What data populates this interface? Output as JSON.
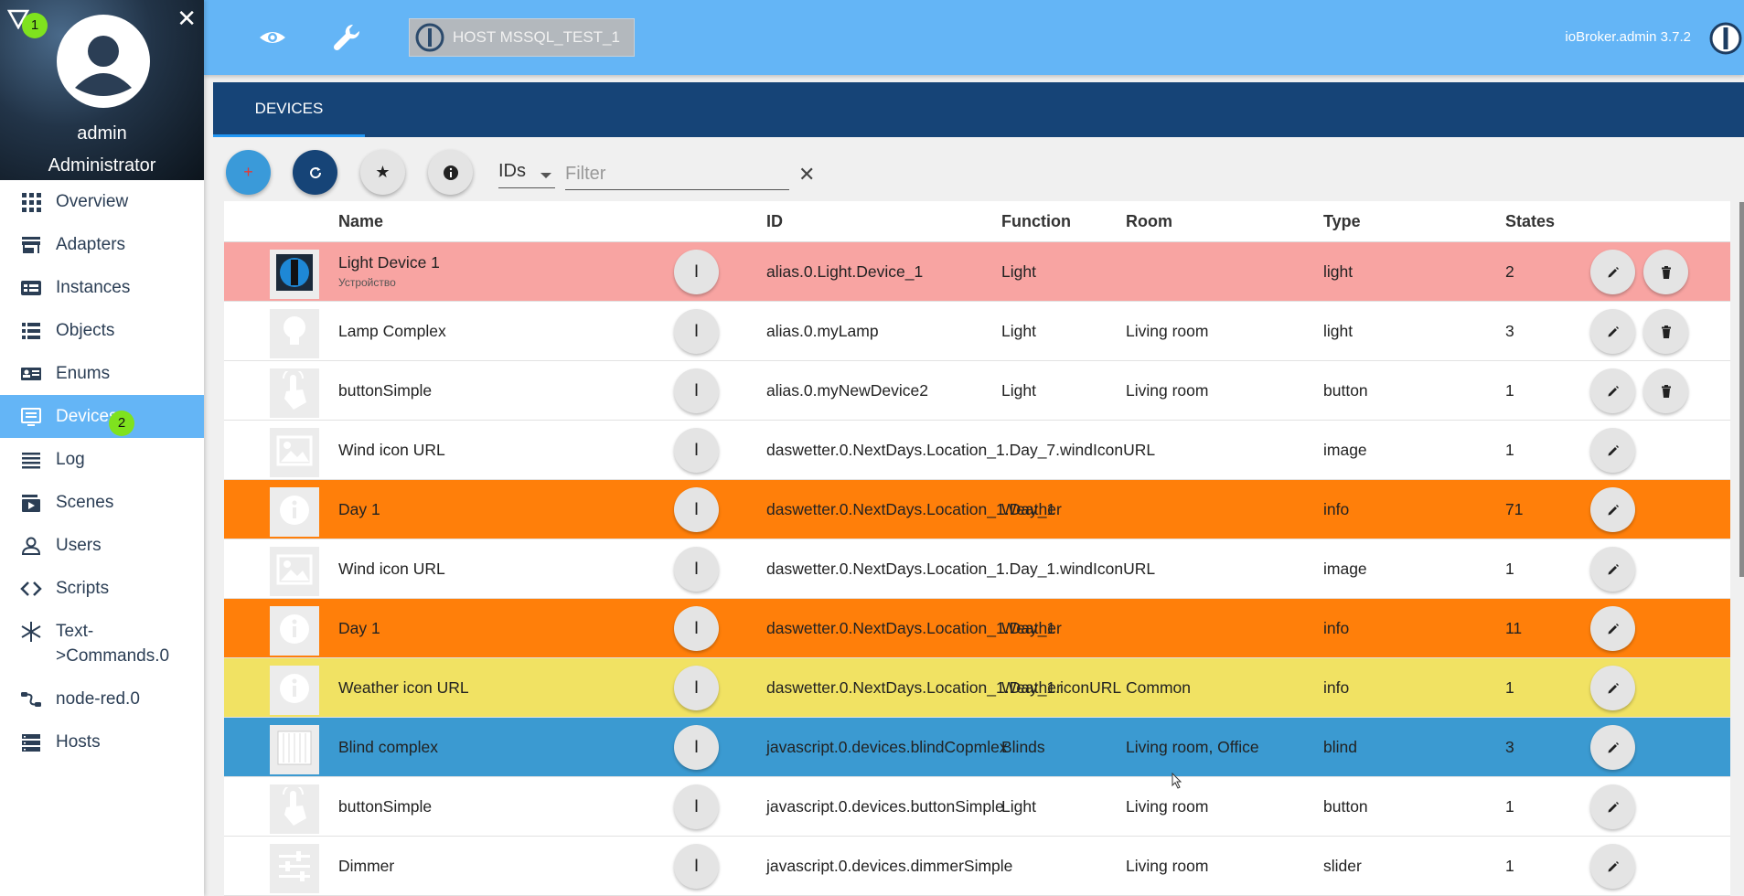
{
  "sidebar": {
    "profile": {
      "name": "admin",
      "role": "Administrator",
      "badge": "1"
    },
    "items": [
      {
        "label": "Overview",
        "icon": "grid-icon"
      },
      {
        "label": "Adapters",
        "icon": "store-icon"
      },
      {
        "label": "Instances",
        "icon": "instances-icon"
      },
      {
        "label": "Objects",
        "icon": "list-icon"
      },
      {
        "label": "Enums",
        "icon": "enum-icon"
      },
      {
        "label": "Devices",
        "icon": "devices-icon",
        "badge": "2"
      },
      {
        "label": "Log",
        "icon": "log-icon"
      },
      {
        "label": "Scenes",
        "icon": "scenes-icon"
      },
      {
        "label": "Users",
        "icon": "user-icon"
      },
      {
        "label": "Scripts",
        "icon": "code-icon"
      },
      {
        "label": "Text-\n>Commands.0",
        "icon": "snowflake-icon"
      },
      {
        "label": "node-red.0",
        "icon": "node-red-icon"
      },
      {
        "label": "Hosts",
        "icon": "hosts-icon"
      }
    ]
  },
  "topbar": {
    "host": "HOST MSSQL_TEST_1",
    "version": "ioBroker.admin 3.7.2"
  },
  "tabs": {
    "devices": "DEVICES"
  },
  "toolbar": {
    "ids_select": "IDs",
    "filter_placeholder": "Filter"
  },
  "table": {
    "headers": {
      "name": "Name",
      "id": "ID",
      "function": "Function",
      "room": "Room",
      "type": "Type",
      "states": "States"
    },
    "rows": [
      {
        "name": "Light Device 1",
        "sub": "Устройство",
        "id": "alias.0.Light.Device_1",
        "function": "Light",
        "room": "",
        "type": "light",
        "states": "2",
        "bg": "#f8a4a2",
        "icon": "iobroker-logo-icon",
        "delete": true
      },
      {
        "name": "Lamp Complex",
        "sub": "",
        "id": "alias.0.myLamp",
        "function": "Light",
        "room": "Living room",
        "type": "light",
        "states": "3",
        "bg": "#ffffff",
        "icon": "bulb-icon",
        "delete": true
      },
      {
        "name": "buttonSimple",
        "sub": "",
        "id": "alias.0.myNewDevice2",
        "function": "Light",
        "room": "Living room",
        "type": "button",
        "states": "1",
        "bg": "#ffffff",
        "icon": "touch-icon",
        "delete": true
      },
      {
        "name": "Wind icon URL",
        "sub": "",
        "id": "daswetter.0.NextDays.Location_1.Day_7.windIconURL",
        "function": "",
        "room": "",
        "type": "image",
        "states": "1",
        "bg": "#ffffff",
        "icon": "image-icon",
        "delete": false
      },
      {
        "name": "Day 1",
        "sub": "",
        "id": "daswetter.0.NextDays.Location_1.Day_1",
        "function": "Weather",
        "room": "",
        "type": "info",
        "states": "71",
        "bg": "#ff7f0a",
        "icon": "info-icon",
        "delete": false
      },
      {
        "name": "Wind icon URL",
        "sub": "",
        "id": "daswetter.0.NextDays.Location_1.Day_1.windIconURL",
        "function": "",
        "room": "",
        "type": "image",
        "states": "1",
        "bg": "#ffffff",
        "icon": "image-icon",
        "delete": false
      },
      {
        "name": "Day 1",
        "sub": "",
        "id": "daswetter.0.NextDays.Location_1.Day_1",
        "function": "Weather",
        "room": "",
        "type": "info",
        "states": "11",
        "bg": "#ff7f0a",
        "icon": "info-icon",
        "delete": false
      },
      {
        "name": "Weather icon URL",
        "sub": "",
        "id": "daswetter.0.NextDays.Location_1.Day_1.iconURL",
        "function": "Weather",
        "room": "Common",
        "type": "info",
        "states": "1",
        "bg": "#f1e263",
        "icon": "info-icon",
        "delete": false
      },
      {
        "name": "Blind complex",
        "sub": "",
        "id": "javascript.0.devices.blindCopmlex",
        "function": "Blinds",
        "room": "Living room, Office",
        "type": "blind",
        "states": "3",
        "bg": "#3b9ad1",
        "icon": "blind-icon",
        "delete": false
      },
      {
        "name": "buttonSimple",
        "sub": "",
        "id": "javascript.0.devices.buttonSimple",
        "function": "Light",
        "room": "Living room",
        "type": "button",
        "states": "1",
        "bg": "#ffffff",
        "icon": "touch-icon",
        "delete": false
      },
      {
        "name": "Dimmer",
        "sub": "",
        "id": "javascript.0.devices.dimmerSimple",
        "function": "",
        "room": "Living room",
        "type": "slider",
        "states": "1",
        "bg": "#ffffff",
        "icon": "sliders-icon",
        "delete": false
      }
    ]
  },
  "colors": {
    "topbar": "#64b5f6",
    "tabbar": "#164477",
    "active_nav": "#64b5f6",
    "add_button": "#3a9ad9",
    "refresh_button": "#164477"
  }
}
